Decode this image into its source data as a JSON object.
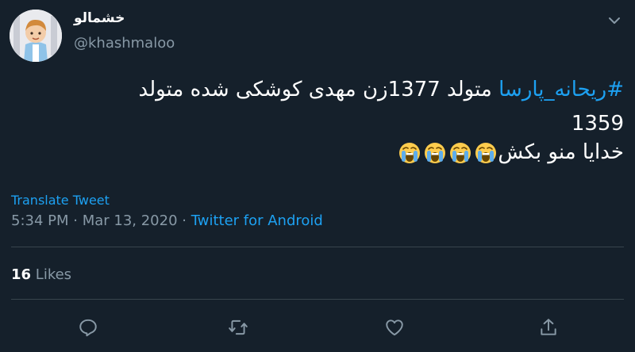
{
  "author": {
    "name": "خشمالو",
    "handle": "@khashmaloo"
  },
  "tweet": {
    "hashtag": "#ریحانه_پارسا",
    "line1_text": " متولد 1377زن مهدی کوشکی شده متولد",
    "line2_text": "1359",
    "line3_text": "خدایا منو بکش",
    "emoji": "loudly-crying-face",
    "emoji_count": 4
  },
  "translate_label": "Translate Tweet",
  "timestamp": {
    "time": "5:34 PM",
    "sep1": " · ",
    "date": "Mar 13, 2020",
    "sep2": " · ",
    "source": "Twitter for Android"
  },
  "stats": {
    "likes_count": "16",
    "likes_label": " Likes"
  },
  "actions": {
    "reply": "reply-icon",
    "retweet": "retweet-icon",
    "like": "like-icon",
    "share": "share-icon"
  }
}
